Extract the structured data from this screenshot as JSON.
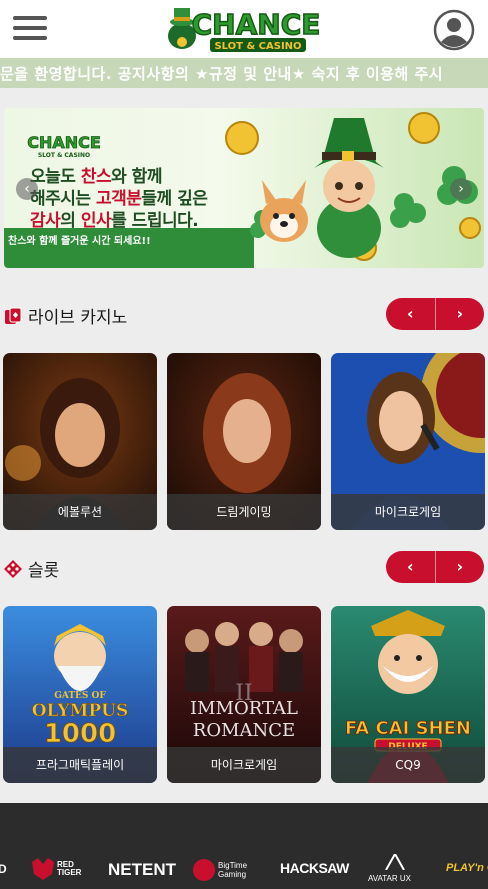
{
  "header": {
    "logo_text": "CHANCE",
    "logo_sub": "SLOT & CASINO"
  },
  "marquee": {
    "text": "문을 환영합니다. 공지사항의 ★규정 및 안내★ 숙지 후 이용해 주시"
  },
  "banner": {
    "logo_text": "CHANCE",
    "logo_sub": "SLOT & CASINO",
    "line1_a": "오늘도 ",
    "line1_hl": "찬스",
    "line1_b": "와 함께",
    "line2_a": "해주시는 ",
    "line2_hl": "고객분",
    "line2_b": "들께 깊은",
    "line3_hl": "감사",
    "line3_a": "의 ",
    "line3_hl2": "인사",
    "line3_b": "를 드립니다.",
    "subline": "찬스와 함께 즐거운 시간 되세요!!",
    "prev": "‹",
    "next": "›"
  },
  "live_casino": {
    "title": "라이브 카지노",
    "prev": "‹",
    "next": "›",
    "cards": [
      {
        "label": "에볼루션"
      },
      {
        "label": "드림게이밍"
      },
      {
        "label": "마이크로게임"
      }
    ]
  },
  "slot": {
    "title": "슬롯",
    "prev": "‹",
    "next": "›",
    "cards": [
      {
        "label": "프라그매틱플레이",
        "art_line1": "GATES OF",
        "art_line2": "OLYMPUS",
        "art_line3": "1000"
      },
      {
        "label": "마이크로게임",
        "art_line1": "IMMORTAL",
        "art_line2": "ROMANCE",
        "art_line3": "II"
      },
      {
        "label": "CQ9",
        "art_line1": "FA CAI SHEN",
        "art_line2": "DELUXE"
      }
    ]
  },
  "providers": [
    {
      "name": "D"
    },
    {
      "name": "RED TIGER"
    },
    {
      "name": "NETENT"
    },
    {
      "name": "BigTime Gaming"
    },
    {
      "name": "HACKSAW"
    },
    {
      "name": "AVATAR UX"
    },
    {
      "name": "PLAY'n GO"
    }
  ],
  "colors": {
    "accent": "#c8102e",
    "marquee_bg": "#c7d8b9",
    "footer_bg": "#2c2c2c"
  }
}
